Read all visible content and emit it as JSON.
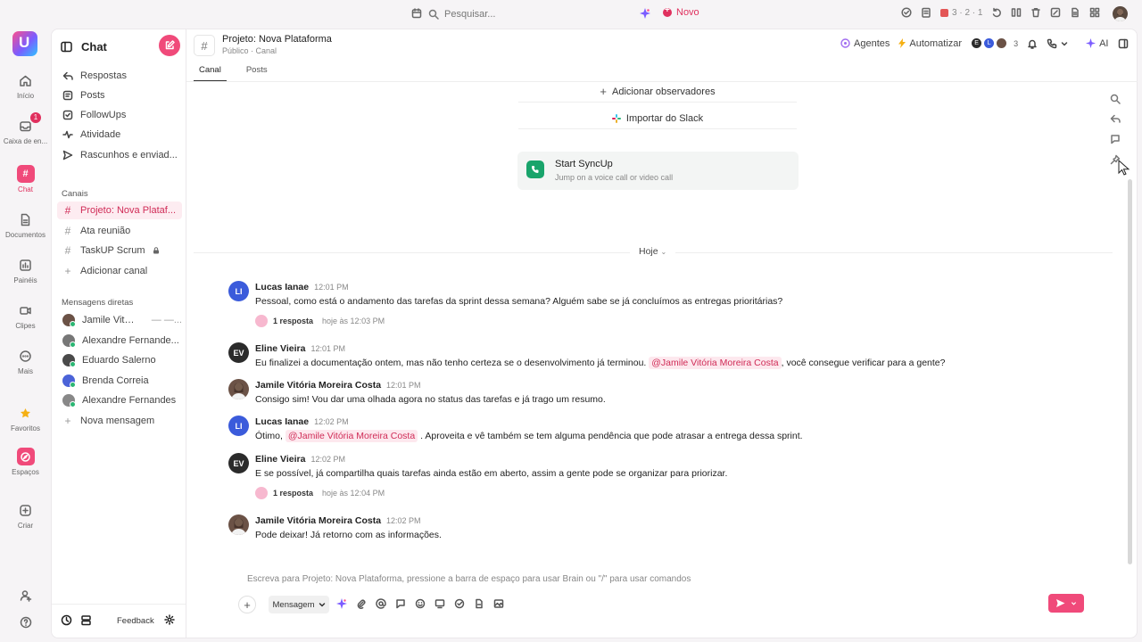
{
  "topbar": {
    "search_placeholder": "Pesquisar...",
    "new_label": "Novo",
    "recording_counts": "3 · 2 · 1"
  },
  "rail": {
    "items": [
      {
        "label": "Início",
        "icon": "home-icon"
      },
      {
        "label": "Caixa de en...",
        "icon": "inbox-icon",
        "badge": "1"
      },
      {
        "label": "Chat",
        "icon": "chat-icon"
      },
      {
        "label": "Documentos",
        "icon": "docs-icon"
      },
      {
        "label": "Painéis",
        "icon": "dashboards-icon"
      },
      {
        "label": "Clipes",
        "icon": "clips-icon"
      },
      {
        "label": "Mais",
        "icon": "more-icon"
      },
      {
        "label": "Favoritos",
        "icon": "star-icon"
      },
      {
        "label": "Espaços",
        "icon": "spaces-icon"
      },
      {
        "label": "Criar",
        "icon": "create-icon"
      }
    ]
  },
  "sidebar": {
    "title": "Chat",
    "nav": [
      "Respostas",
      "Posts",
      "FollowUps",
      "Atividade",
      "Rascunhos e enviad..."
    ],
    "channels_title": "Canais",
    "channels": [
      "Projeto: Nova Plataf...",
      "Ata reunião",
      "TaskUP Scrum"
    ],
    "add_channel": "Adicionar canal",
    "dm_title": "Mensagens diretas",
    "dms": [
      "Jamile Vitória ...",
      "Alexandre Fernande...",
      "Eduardo Salerno",
      "Brenda Correia",
      "Alexandre Fernandes"
    ],
    "dm_extra": "— —...",
    "new_message": "Nova mensagem",
    "feedback": "Feedback"
  },
  "header": {
    "title": "Projeto: Nova Plataforma",
    "subtitle": "Público · Canal",
    "tabs": [
      "Canal",
      "Posts"
    ],
    "agents": "Agentes",
    "automate": "Automatizar",
    "member_count": "3",
    "ai": "AI"
  },
  "channel": {
    "add_watchers": "Adicionar observadores",
    "import_slack": "Importar do Slack",
    "syncup_title": "Start SyncUp",
    "syncup_sub": "Jump on a voice call or video call",
    "day_label": "Hoje"
  },
  "messages": [
    {
      "initials": "LI",
      "name": "Lucas Ianae",
      "time": "12:01 PM",
      "text": "Pessoal, como está o andamento das tarefas da sprint dessa semana? Alguém sabe se já concluímos as entregas prioritárias?",
      "reply_count": "1 resposta",
      "reply_time": "hoje às 12:03 PM"
    },
    {
      "initials": "EV",
      "name": "Eline Vieira",
      "time": "12:01 PM",
      "pre": "Eu finalizei a documentação ontem, mas não tenho certeza se o desenvolvimento já terminou.",
      "mention": "@Jamile Vitória Moreira Costa",
      "post": ", você consegue verificar para a gente?"
    },
    {
      "name": "Jamile Vitória Moreira Costa",
      "time": "12:01 PM",
      "text": "Consigo sim! Vou dar uma olhada agora no status das tarefas e já trago um resumo."
    },
    {
      "initials": "LI",
      "name": "Lucas Ianae",
      "time": "12:02 PM",
      "pre": "Ótimo,",
      "mention": "@Jamile Vitória Moreira Costa",
      "post": ". Aproveita e vê também se tem alguma pendência que pode atrasar a entrega dessa sprint."
    },
    {
      "initials": "EV",
      "name": "Eline Vieira",
      "time": "12:02 PM",
      "text": "E se possível, já compartilha quais tarefas ainda estão em aberto, assim a gente pode se organizar para priorizar.",
      "reply_count": "1 resposta",
      "reply_time": "hoje às 12:04 PM"
    },
    {
      "name": "Jamile Vitória Moreira Costa",
      "time": "12:02 PM",
      "text": "Pode deixar! Já retorno com as informações."
    }
  ],
  "composer": {
    "placeholder": "Escreva para Projeto: Nova Plataforma, pressione a barra de espaço para usar Brain ou \"/\" para usar comandos",
    "mode": "Mensagem"
  },
  "colors": {
    "accent": "#f04a7a",
    "mention_text": "#d02c57",
    "li_avatar": "#3b5bdb",
    "ev_avatar": "#2b2b2b"
  }
}
